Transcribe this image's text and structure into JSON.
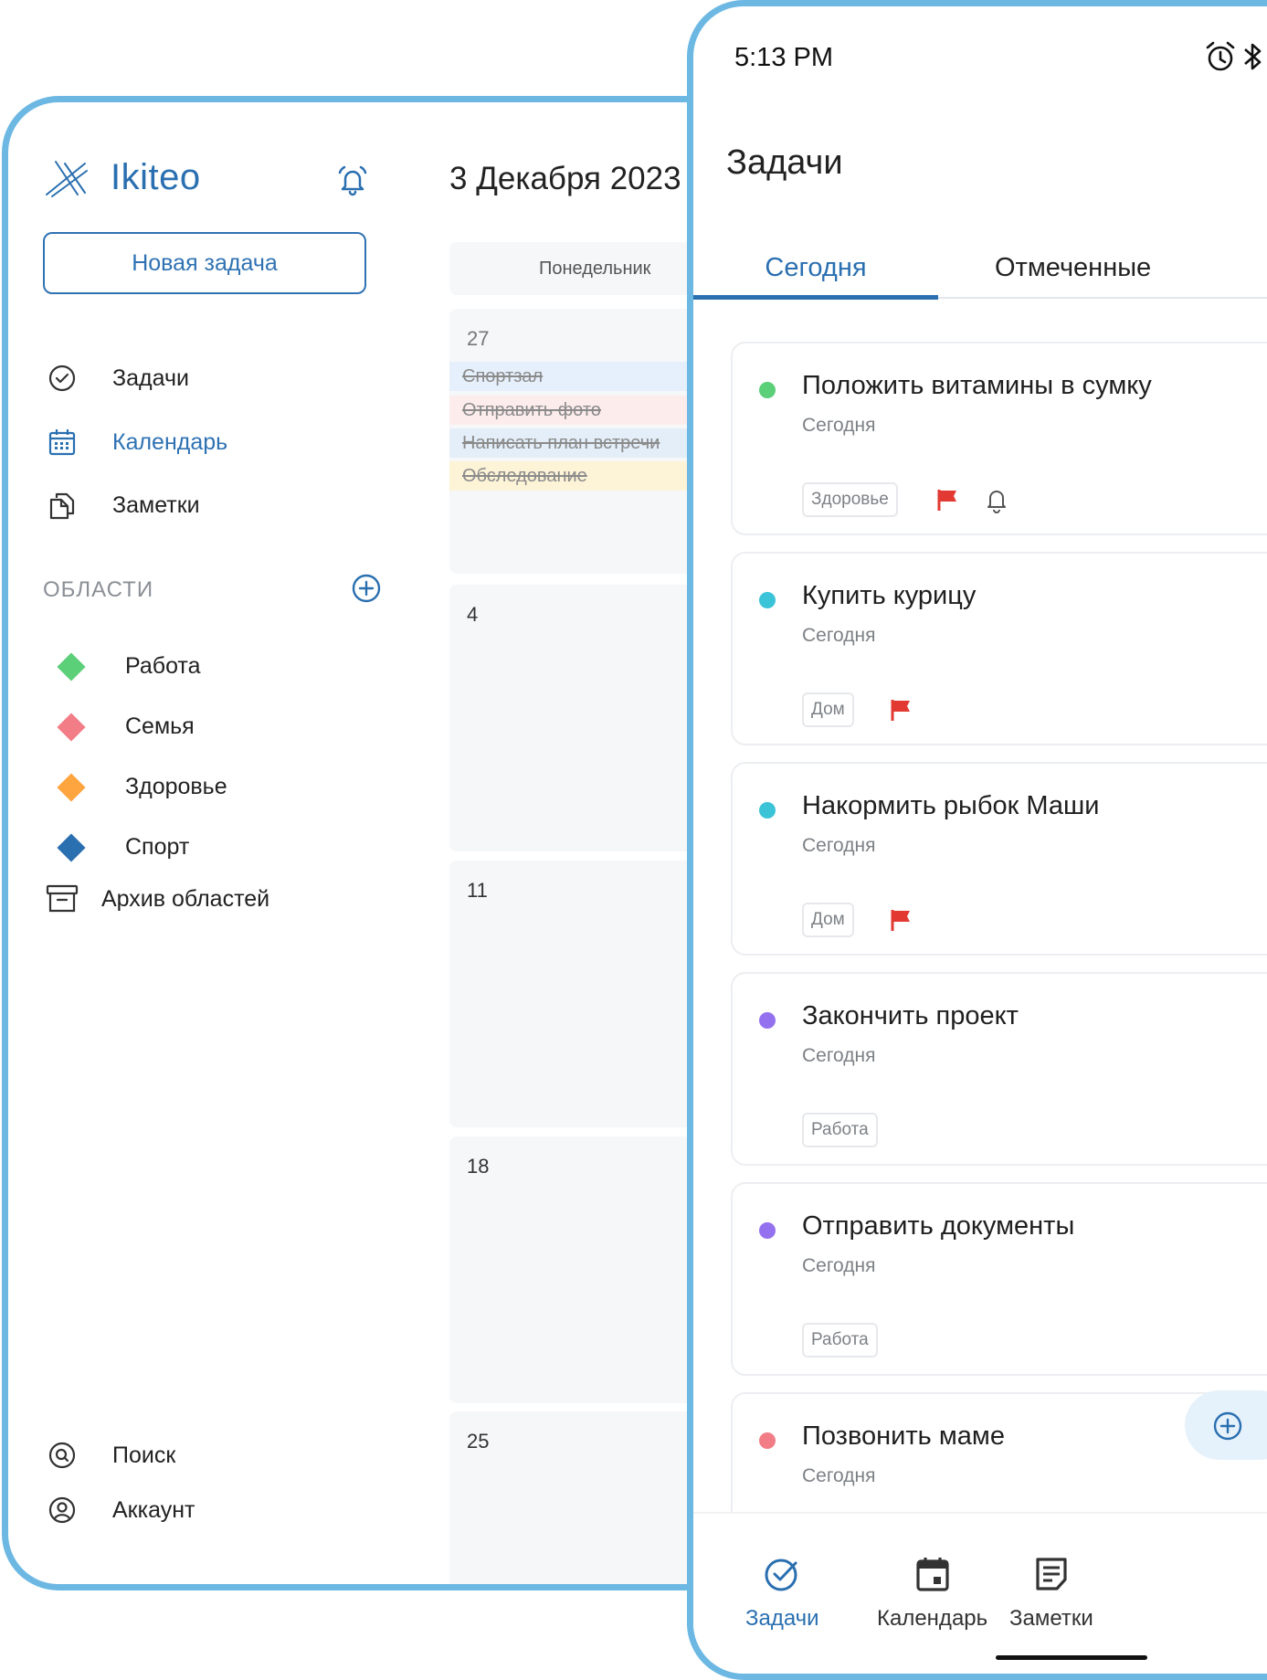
{
  "desktop": {
    "brand": "Ikiteo",
    "new_task_label": "Новая задача",
    "nav": [
      {
        "label": "Задачи",
        "icon": "check-circle-icon"
      },
      {
        "label": "Календарь",
        "icon": "calendar-icon"
      },
      {
        "label": "Заметки",
        "icon": "documents-icon"
      }
    ],
    "areas_title": "ОБЛАСТИ",
    "areas": [
      {
        "label": "Работа",
        "color": "#5ccf79"
      },
      {
        "label": "Семья",
        "color": "#f27d87"
      },
      {
        "label": "Здоровье",
        "color": "#ffa53f"
      },
      {
        "label": "Спорт",
        "color": "#2a6fb0"
      }
    ],
    "archive_label": "Архив областей",
    "bottom_nav": [
      {
        "label": "Поиск",
        "icon": "search-icon"
      },
      {
        "label": "Аккаунт",
        "icon": "account-icon"
      }
    ],
    "calendar": {
      "title": "3 Декабря 2023",
      "weekday": "Понедельник",
      "weeks": [
        {
          "day": "27",
          "events": [
            {
              "label": "Спортзал",
              "color": "#e6f0fc"
            },
            {
              "label": "Отправить фото",
              "color": "#fdecec"
            },
            {
              "label": "Написать план встречи",
              "color": "#e3eef8"
            },
            {
              "label": "Обследование",
              "color": "#fdf3d7"
            }
          ]
        },
        {
          "day": "4",
          "events": []
        },
        {
          "day": "11",
          "events": []
        },
        {
          "day": "18",
          "events": []
        },
        {
          "day": "25",
          "events": []
        }
      ]
    }
  },
  "phone": {
    "status_time": "5:13 PM",
    "screen_title": "Задачи",
    "tabs": [
      "Сегодня",
      "Отмеченные"
    ],
    "tasks": [
      {
        "title": "Положить витамины в сумку",
        "due": "Сегодня",
        "tag": "Здоровье",
        "dot": "#5ccf79",
        "flag": true,
        "reminder": true
      },
      {
        "title": "Купить курицу",
        "due": "Сегодня",
        "tag": "Дом",
        "dot": "#3bc3d8",
        "flag": true,
        "reminder": false
      },
      {
        "title": "Накормить рыбок Маши",
        "due": "Сегодня",
        "tag": "Дом",
        "dot": "#3bc3d8",
        "flag": true,
        "reminder": false
      },
      {
        "title": "Закончить проект",
        "due": "Сегодня",
        "tag": "Работа",
        "dot": "#9471ee",
        "flag": false,
        "reminder": false
      },
      {
        "title": "Отправить документы",
        "due": "Сегодня",
        "tag": "Работа",
        "dot": "#9471ee",
        "flag": false,
        "reminder": false
      },
      {
        "title": "Позвонить маме",
        "due": "Сегодня",
        "tag": "",
        "dot": "#f27d87",
        "flag": false,
        "reminder": false
      }
    ],
    "bottom_nav": [
      {
        "label": "Задачи",
        "icon": "tasks-check-icon"
      },
      {
        "label": "Календарь",
        "icon": "calendar-icon"
      },
      {
        "label": "Заметки",
        "icon": "notes-icon"
      }
    ],
    "accent": "#2a6fb0",
    "flag_color": "#e23a32"
  }
}
